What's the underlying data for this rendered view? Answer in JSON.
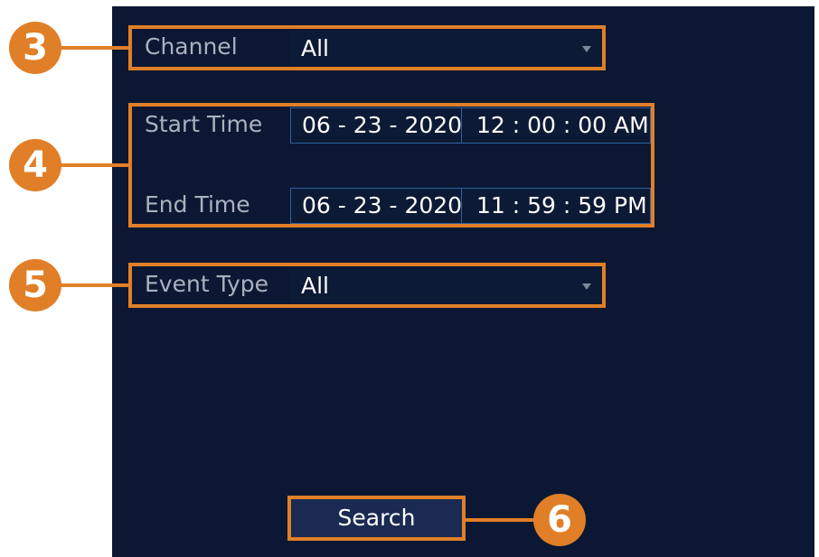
{
  "form": {
    "channel": {
      "label": "Channel",
      "value": "All"
    },
    "start_time": {
      "label": "Start Time",
      "date": "06 - 23 - 2020",
      "time": "12 : 00 : 00 AM"
    },
    "end_time": {
      "label": "End Time",
      "date": "06 - 23 - 2020",
      "time": "11 : 59 : 59 PM"
    },
    "event_type": {
      "label": "Event Type",
      "value": "All"
    },
    "search_label": "Search"
  },
  "callouts": [
    "3",
    "4",
    "5",
    "6"
  ],
  "colors": {
    "panel_background": "#0c1833",
    "callout_orange": "#e07f27",
    "field_border": "#2f5fa0",
    "label_gray": "#aab1bf"
  },
  "icons": {
    "dropdown": "chevron-down-icon"
  }
}
